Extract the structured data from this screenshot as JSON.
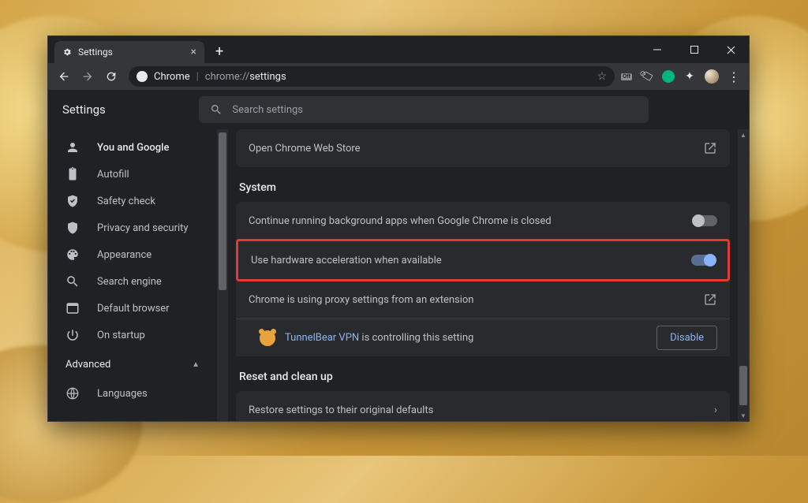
{
  "tab": {
    "title": "Settings"
  },
  "omnibox": {
    "scheme_label": "Chrome",
    "path_prefix": "chrome://",
    "path": "settings"
  },
  "header": {
    "title": "Settings"
  },
  "search": {
    "placeholder": "Search settings"
  },
  "sidebar": {
    "items": [
      {
        "label": "You and Google"
      },
      {
        "label": "Autofill"
      },
      {
        "label": "Safety check"
      },
      {
        "label": "Privacy and security"
      },
      {
        "label": "Appearance"
      },
      {
        "label": "Search engine"
      },
      {
        "label": "Default browser"
      },
      {
        "label": "On startup"
      }
    ],
    "advanced_label": "Advanced",
    "adv_items": [
      {
        "label": "Languages"
      }
    ]
  },
  "sections": {
    "top_row_link": "Open Chrome Web Store",
    "system": {
      "title": "System",
      "bg_apps": {
        "label": "Continue running background apps when Google Chrome is closed",
        "on": false
      },
      "hw_accel": {
        "label": "Use hardware acceleration when available",
        "on": true
      },
      "proxy": {
        "label": "Chrome is using proxy settings from an extension",
        "ext_name": "TunnelBear VPN",
        "ctrl_text": " is controlling this setting",
        "disable_label": "Disable"
      }
    },
    "reset": {
      "title": "Reset and clean up",
      "restore_label": "Restore settings to their original defaults"
    }
  }
}
